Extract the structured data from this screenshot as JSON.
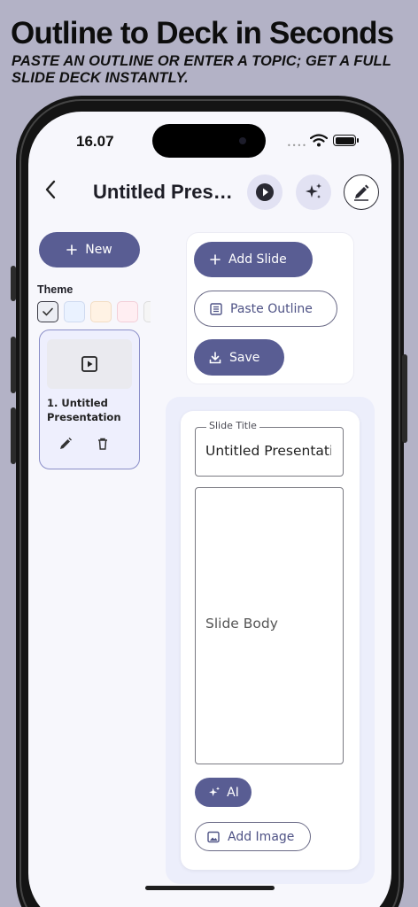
{
  "promo": {
    "headline": "Outline to Deck in Seconds",
    "subline": "Paste an outline or enter a topic; get a full slide deck instantly."
  },
  "status_bar": {
    "time": "16.07",
    "signal_icon": "signal-dots-icon",
    "wifi_icon": "wifi-icon",
    "battery_icon": "battery-icon"
  },
  "nav": {
    "back_icon": "chevron-left-icon",
    "title": "Untitled Presentation",
    "actions": [
      {
        "name": "play-button",
        "icon": "play-icon"
      },
      {
        "name": "ai-magic-button",
        "icon": "sparkles-icon"
      },
      {
        "name": "edit-button",
        "icon": "pencil-icon"
      }
    ]
  },
  "sidebar": {
    "new_label": "New",
    "theme_label": "Theme",
    "themes": [
      {
        "color": "#eceef4",
        "border": "#3c3c46",
        "selected": true
      },
      {
        "color": "#eaf2ff",
        "border": "#cfdaf0",
        "selected": false
      },
      {
        "color": "#fff2e4",
        "border": "#f2ddc4",
        "selected": false
      },
      {
        "color": "#ffeef2",
        "border": "#f2cfd8",
        "selected": false
      },
      {
        "color": "#f5f5f5",
        "border": "#dddddd",
        "selected": false
      }
    ],
    "slides": [
      {
        "title": "1. Untitled Presentation"
      }
    ]
  },
  "actions": {
    "add_slide": "Add Slide",
    "paste_outline": "Paste Outline",
    "save": "Save"
  },
  "editor": {
    "slide_title_label": "Slide Title",
    "slide_title_value": "Untitled Presentation",
    "slide_body_placeholder": "Slide Body",
    "ai_label": "AI",
    "add_image_label": "Add Image"
  },
  "colors": {
    "primary": "#595d93",
    "background": "#b3b2c6",
    "accent_light": "#e2e2f3"
  }
}
